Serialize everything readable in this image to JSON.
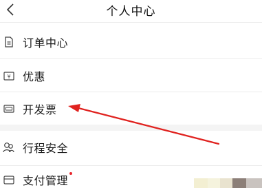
{
  "header": {
    "title": "个人中心",
    "back_icon": "chevron-left-icon"
  },
  "menu": {
    "items": [
      {
        "label": "订单中心",
        "icon": "document-icon"
      },
      {
        "label": "优惠",
        "icon": "coupon-icon"
      },
      {
        "label": "开发票",
        "icon": "invoice-icon"
      },
      {
        "label": "行程安全",
        "icon": "people-icon"
      },
      {
        "label": "支付管理",
        "icon": "wallet-icon",
        "badge": "red-dot"
      }
    ]
  },
  "annotation": {
    "color": "#e0221f",
    "target": "开发票"
  },
  "colors": {
    "background": "#ffffff",
    "divider": "#ececec",
    "section_gap": "#f4f4f4",
    "text": "#1b1b1b",
    "badge": "#e8262d"
  }
}
